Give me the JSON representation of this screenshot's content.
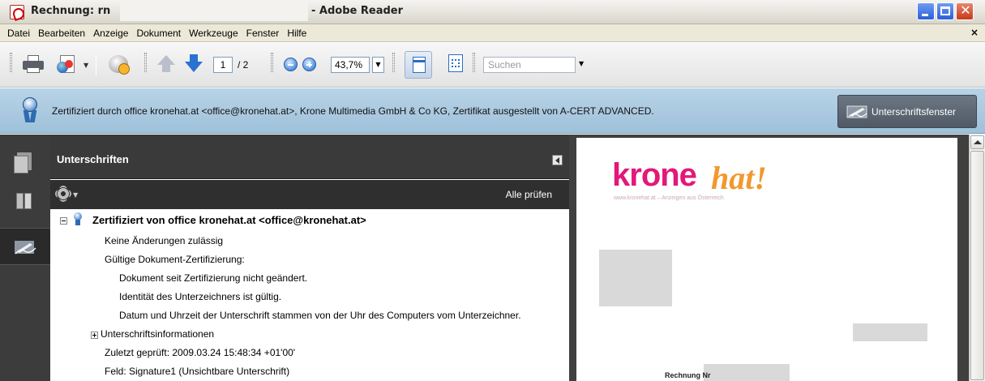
{
  "window": {
    "title_prefix": "Rechnung: rn",
    "title_suffix": "- Adobe Reader",
    "buttons": [
      "minimize",
      "maximize",
      "close"
    ]
  },
  "menu": {
    "items": [
      "Datei",
      "Bearbeiten",
      "Anzeige",
      "Dokument",
      "Werkzeuge",
      "Fenster",
      "Hilfe"
    ],
    "close_glyph": "×"
  },
  "toolbar": {
    "page_current": "1",
    "page_total": "/ 2",
    "zoom": "43,7%",
    "search_placeholder": "Suchen",
    "icons": [
      "print-icon",
      "export-icon",
      "review-icon",
      "prev-page-icon",
      "next-page-icon",
      "zoom-out-icon",
      "zoom-in-icon",
      "fit-width-icon",
      "fit-page-icon"
    ]
  },
  "cert_bar": {
    "text": "Zertifiziert durch office kronehat.at <office@kronehat.at>, Krone Multimedia GmbH & Co KG, Zertifikat ausgestellt von A-CERT ADVANCED.",
    "button_label": "Unterschriftsfenster"
  },
  "nav": {
    "buttons": [
      "pages-icon",
      "bookmarks-icon",
      "signatures-icon"
    ],
    "active": "signatures-icon"
  },
  "signatures_panel": {
    "title": "Unterschriften",
    "verify_all": "Alle prüfen",
    "tree": {
      "root": "Zertifiziert von office kronehat.at <office@kronehat.at>",
      "no_changes": "Keine Änderungen zulässig",
      "valid_cert": "Gültige Dokument-Zertifizierung:",
      "unchanged": "Dokument seit Zertifizierung nicht geändert.",
      "identity": "Identität des Unterzeichners ist gültig.",
      "time": "Datum und Uhrzeit der Unterschrift stammen von der Uhr des Computers vom Unterzeichner.",
      "sig_info": "Unterschriftsinformationen",
      "last_checked": "Zuletzt geprüft: 2009.03.24 15:48:34 +01'00'",
      "field": "Feld: Signature1 (Unsichtbare Unterschrift)"
    }
  },
  "document": {
    "logo_main": "krone",
    "logo_accent": "hat!",
    "logo_tagline": "www.kronehat.at – Anzeigen aus Österreich",
    "invoice_label": "Rechnung Nr",
    "colors": {
      "logo_pink": "#e2187a",
      "logo_orange": "#f2982e"
    }
  }
}
